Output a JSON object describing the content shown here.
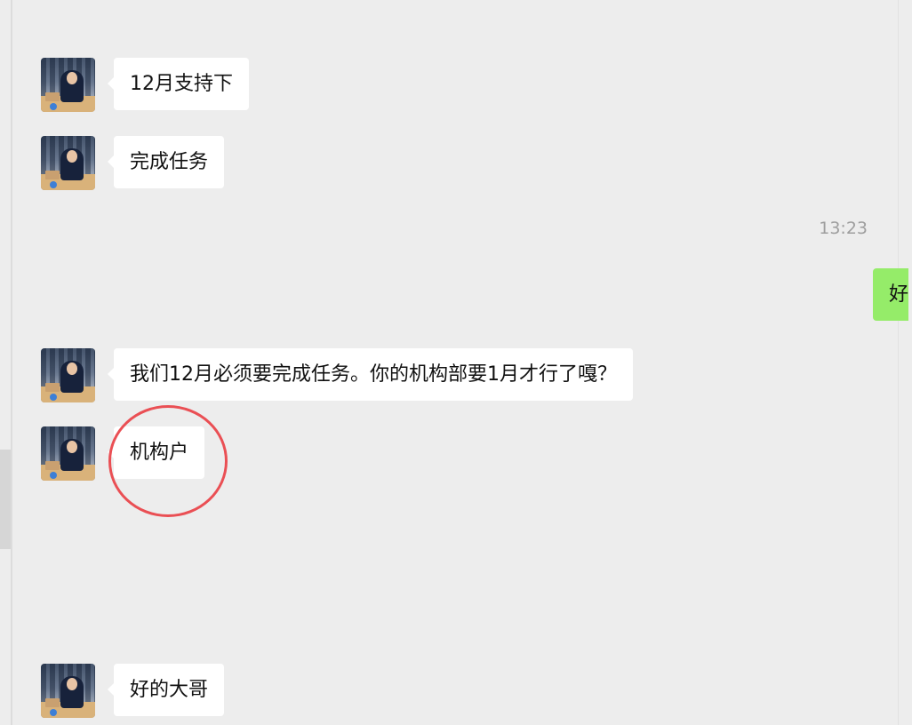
{
  "chat": {
    "messages": [
      {
        "sender": "contact",
        "text": "12月支持下"
      },
      {
        "sender": "contact",
        "text": "完成任务"
      },
      {
        "sender": "contact",
        "text": "我们12月必须要完成任务。你的机构部要1月才行了嘎？"
      },
      {
        "sender": "contact",
        "text": "机构户"
      },
      {
        "sender": "contact",
        "text": "好的大哥"
      }
    ],
    "timestamp": "13:23",
    "self_message": {
      "sender": "self",
      "text": "好"
    }
  },
  "colors": {
    "background": "#ededed",
    "incoming_bubble": "#ffffff",
    "outgoing_bubble": "#95ec69",
    "annotation": "#ea4f54",
    "timestamp_text": "#9e9e9e"
  },
  "icons": {
    "avatar": "contact-avatar-photo"
  },
  "annotations": {
    "highlight_circle": "red-circle-around-message"
  }
}
